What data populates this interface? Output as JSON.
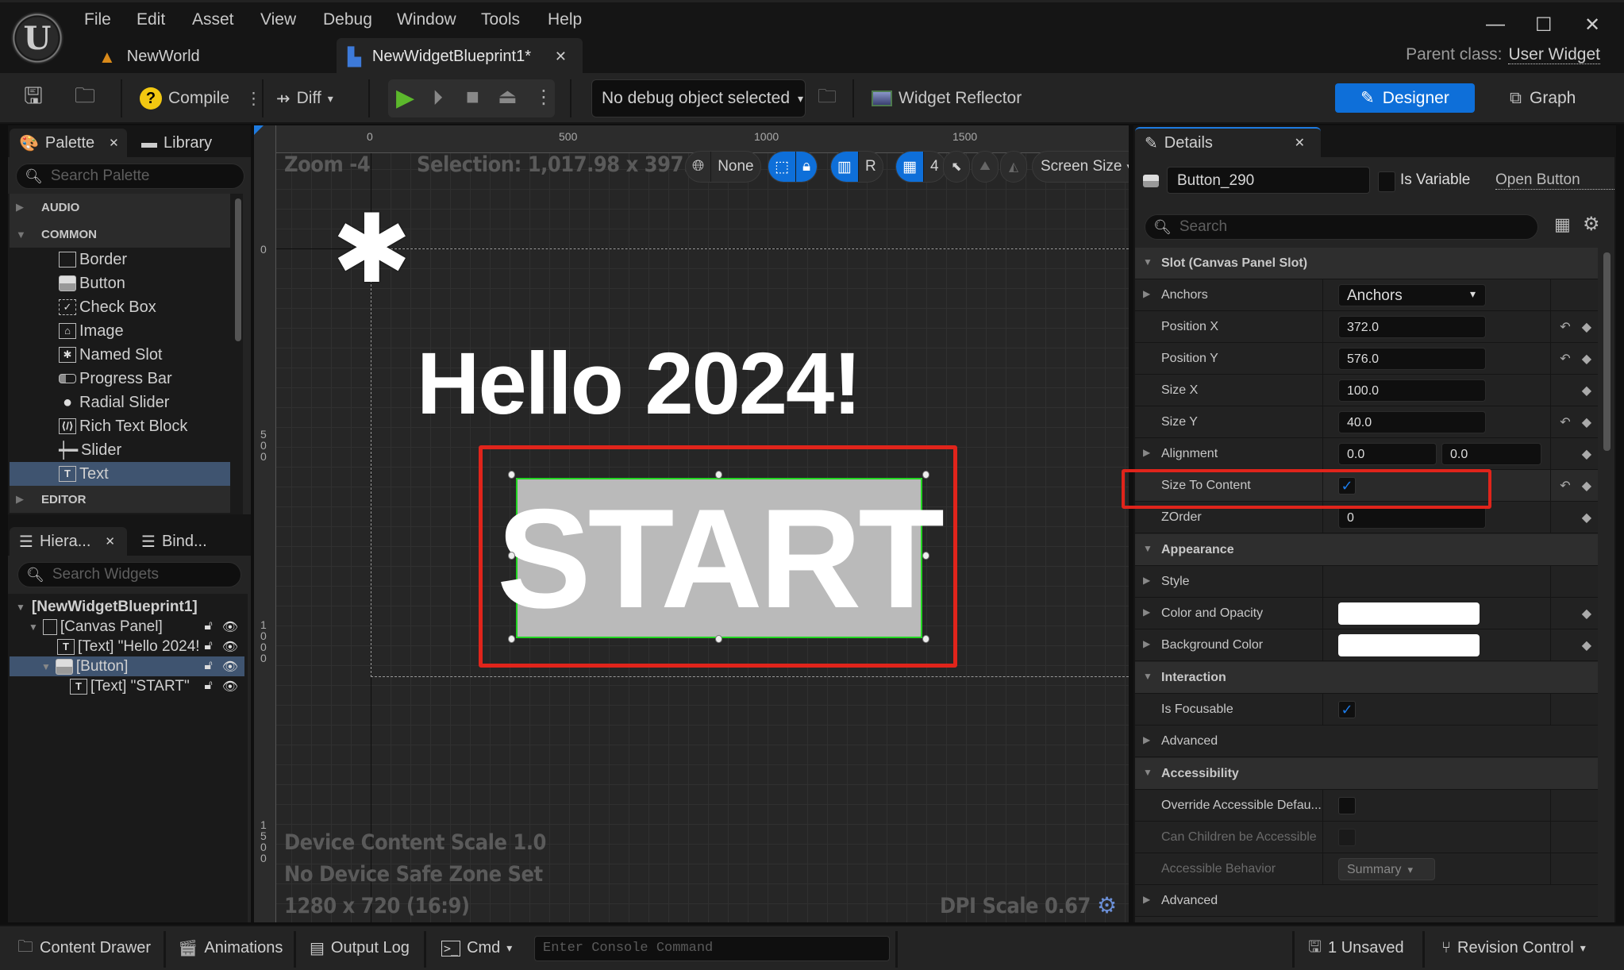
{
  "app": {
    "menu": [
      "File",
      "Edit",
      "Asset",
      "View",
      "Debug",
      "Window",
      "Tools",
      "Help"
    ],
    "tabs": [
      {
        "label": "NewWorld",
        "icon": "level-icon"
      },
      {
        "label": "NewWidgetBlueprint1*",
        "icon": "widget-blueprint-icon",
        "active": true
      }
    ],
    "parent_class_label": "Parent class:",
    "parent_class_value": "User Widget",
    "window_controls": {
      "minimize": "—",
      "maximize": "☐",
      "close": "✕"
    }
  },
  "toolbar": {
    "compile_label": "Compile",
    "diff_label": "Diff",
    "debug_object": "No debug object selected",
    "widget_reflector": "Widget Reflector",
    "designer_label": "Designer",
    "graph_label": "Graph",
    "accent_color": "#0e6fd9"
  },
  "palette": {
    "tab_label": "Palette",
    "library_label": "Library",
    "search_placeholder": "Search Palette",
    "categories": [
      {
        "label": "AUDIO",
        "expanded": false
      },
      {
        "label": "COMMON",
        "expanded": true
      },
      {
        "label": "EDITOR",
        "expanded": false
      }
    ],
    "items": [
      {
        "label": "Border",
        "icon": "▭"
      },
      {
        "label": "Button",
        "icon": "▬"
      },
      {
        "label": "Check Box",
        "icon": "☑"
      },
      {
        "label": "Image",
        "icon": "▣"
      },
      {
        "label": "Named Slot",
        "icon": "✱"
      },
      {
        "label": "Progress Bar",
        "icon": "▭"
      },
      {
        "label": "Radial Slider",
        "icon": "•"
      },
      {
        "label": "Rich Text Block",
        "icon": "⁄"
      },
      {
        "label": "Slider",
        "icon": "┿"
      },
      {
        "label": "Text",
        "icon": "T",
        "selected": true
      }
    ]
  },
  "hierarchy": {
    "tab_label": "Hiera...",
    "bind_label": "Bind...",
    "search_placeholder": "Search Widgets",
    "nodes": [
      {
        "label": "[NewWidgetBlueprint1]",
        "depth": 0
      },
      {
        "label": "[Canvas Panel]",
        "depth": 1
      },
      {
        "label": "[Text] \"Hello 2024!",
        "depth": 2
      },
      {
        "label": "[Button]",
        "depth": 2,
        "selected": true
      },
      {
        "label": "[Text] \"START\"",
        "depth": 3
      }
    ]
  },
  "viewport": {
    "zoom": "Zoom -4",
    "selection": "Selection: 1,017.98 x 397.39",
    "localization": "None",
    "grid_snap": "4",
    "respect_locks": "R",
    "screen_size": "Screen Size",
    "ruler_top": [
      "0",
      "500",
      "1000",
      "1500"
    ],
    "ruler_left": [
      "0",
      "500",
      "1000",
      "1500"
    ],
    "hello_text": "Hello 2024!",
    "button_text": "START",
    "device_content_scale": "Device Content Scale 1.0",
    "safe_zone": "No Device Safe Zone Set",
    "resolution": "1280 x 720 (16:9)",
    "dpi_scale": "DPI Scale 0.67"
  },
  "details": {
    "tab_label": "Details",
    "widget_name": "Button_290",
    "is_variable_label": "Is Variable",
    "is_variable": false,
    "open_link": "Open Button",
    "search_placeholder": "Search",
    "sections": {
      "slot": "Slot (Canvas Panel Slot)",
      "appearance": "Appearance",
      "interaction": "Interaction",
      "accessibility": "Accessibility"
    },
    "props": {
      "anchors_label": "Anchors",
      "anchors_value": "Anchors",
      "pos_x_label": "Position X",
      "pos_x": "372.0",
      "pos_y_label": "Position Y",
      "pos_y": "576.0",
      "size_x_label": "Size X",
      "size_x": "100.0",
      "size_y_label": "Size Y",
      "size_y": "40.0",
      "alignment_label": "Alignment",
      "alignment_x": "0.0",
      "alignment_y": "0.0",
      "size_to_content_label": "Size To Content",
      "size_to_content": true,
      "zorder_label": "ZOrder",
      "zorder": "0",
      "style_label": "Style",
      "color_opacity_label": "Color and Opacity",
      "color_opacity": "#ffffff",
      "bg_color_label": "Background Color",
      "bg_color": "#ffffff",
      "is_focusable_label": "Is Focusable",
      "is_focusable": true,
      "advanced_label": "Advanced",
      "override_acc_label": "Override Accessible Defau...",
      "override_acc": false,
      "can_children_label": "Can Children be Accessible",
      "can_children": false,
      "acc_behavior_label": "Accessible Behavior",
      "acc_behavior": "Summary",
      "advanced2_label": "Advanced"
    }
  },
  "statusbar": {
    "content_drawer": "Content Drawer",
    "animations": "Animations",
    "output_log": "Output Log",
    "cmd": "Cmd",
    "console_placeholder": "Enter Console Command",
    "unsaved": "1 Unsaved",
    "revision_control": "Revision Control"
  }
}
